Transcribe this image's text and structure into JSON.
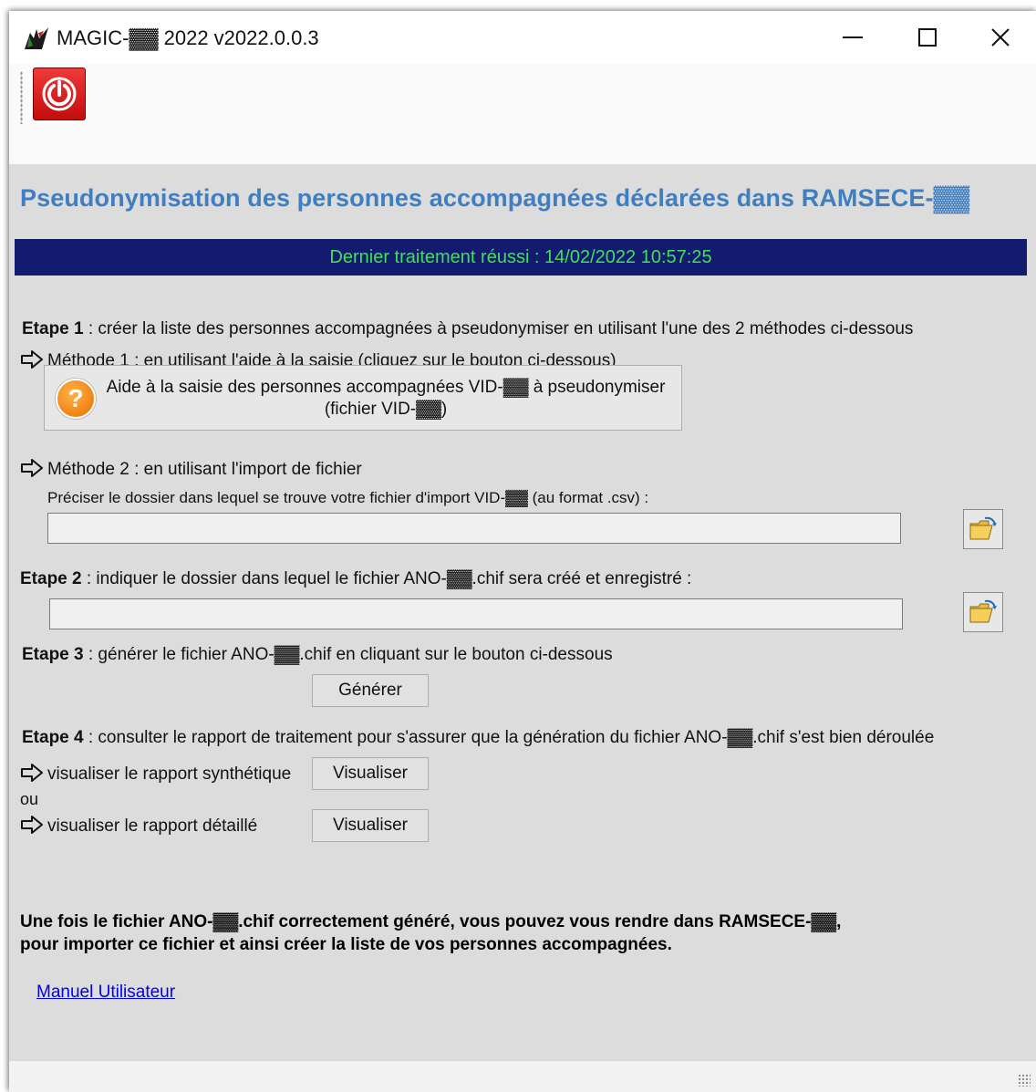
{
  "window": {
    "title": "MAGIC-▓▓ 2022 v2022.0.0.3",
    "minimize_glyph": "—",
    "maximize_glyph": "☐",
    "close_glyph": "✕"
  },
  "toolbar": {
    "power_icon": "power-icon"
  },
  "heading": "Pseudonymisation des personnes accompagnées déclarées dans RAMSECE-▓▓",
  "banner": "Dernier traitement réussi : 14/02/2022 10:57:25",
  "steps": {
    "step1_label": "Etape 1",
    "step1_text": " : créer la liste des personnes accompagnées à pseudonymiser en utilisant l'une des 2 méthodes ci-dessous",
    "method1_text": "Méthode 1 : en utilisant l'aide à la saisie (cliquez sur le bouton ci-dessous)",
    "aide_button_line1": "Aide à la saisie des personnes accompagnées VID-▓▓ à pseudonymiser",
    "aide_button_line2": "(fichier VID-▓▓)",
    "method2_text": "Méthode 2 : en utilisant l'import de fichier",
    "method2_hint": "Préciser le dossier dans lequel se trouve votre fichier d'import VID-▓▓ (au format .csv) :",
    "import_folder_value": "",
    "step2_label": "Etape 2",
    "step2_text": " : indiquer le dossier dans lequel le fichier ANO-▓▓.chif sera créé et enregistré :",
    "output_folder_value": "",
    "step3_label": "Etape 3",
    "step3_text": " : générer le fichier ANO-▓▓.chif en cliquant sur le bouton ci-dessous",
    "generate_label": "Générer",
    "step4_label": "Etape 4",
    "step4_text": " : consulter le rapport de traitement pour s'assurer que la génération du fichier ANO-▓▓.chif s'est bien déroulée",
    "report_synth_text": "visualiser le rapport synthétique",
    "view_synth_label": "Visualiser",
    "or_text": "ou",
    "report_detail_text": "visualiser le rapport détaillé",
    "view_detail_label": "Visualiser"
  },
  "note_line1": "Une fois le fichier ANO-▓▓.chif correctement généré, vous pouvez vous rendre dans RAMSECE-▓▓,",
  "note_line2": "pour importer ce fichier et ainsi créer la liste de vos personnes accompagnées.",
  "manual_link": "Manuel Utilisateur",
  "colors": {
    "heading": "#3f7ec1",
    "banner_bg": "#131b6e",
    "banner_text": "#3fe05a",
    "panel_bg": "#dcdcdc"
  }
}
